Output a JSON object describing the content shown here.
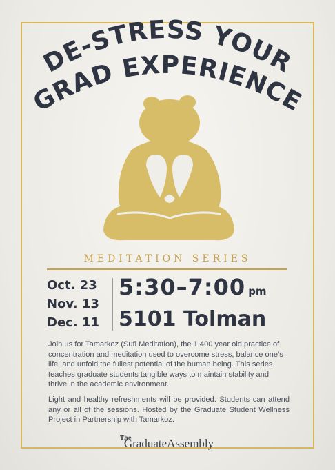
{
  "title": {
    "line1": "DE-STRESS YOUR",
    "line2": "GRAD EXPERIENCE"
  },
  "illustration": {
    "subject": "meditating bear silhouette",
    "color": "#d8bd68"
  },
  "series_label": "MEDITATION SERIES",
  "dates": [
    "Oct. 23",
    "Nov. 13",
    "Dec. 11"
  ],
  "time": {
    "range": "5:30–7:00",
    "suffix": "pm"
  },
  "location": "5101 Tolman",
  "paragraphs": {
    "intro": "Join us for Tamarkoz (Sufi Meditation), the 1,400 year old practice of concentration and meditation used to overcome stress, balance one’s life, and unfold the fullest potential of the human being. This series teaches graduate students tangible ways to maintain stability and thrive in the academic environment.",
    "details": "Light and healthy refreshments will be provided. Students can attend any or all of the sessions. Hosted by the Graduate Student Wellness Project in Partnership with Tamarkoz."
  },
  "logo": {
    "small": "The",
    "name": "GraduateAssembly"
  },
  "colors": {
    "navy": "#2f3442",
    "gold": "#c7a24a",
    "bear": "#d8bd68",
    "paper": "#efeee9"
  }
}
